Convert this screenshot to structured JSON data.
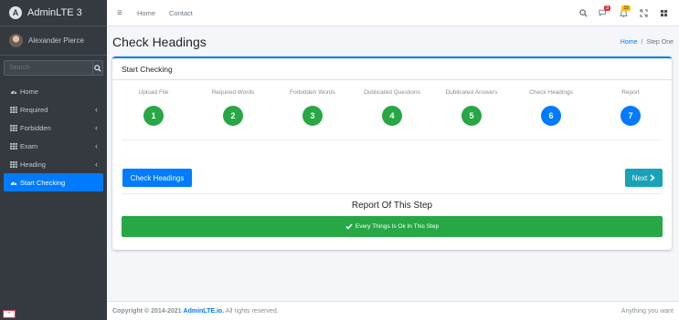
{
  "brand": {
    "name": "AdminLTE 3",
    "logo_letter": "A"
  },
  "user": {
    "name": "Alexander Pierce"
  },
  "sidebar": {
    "search_placeholder": "Search",
    "items": [
      {
        "label": "Home",
        "icon": "tachometer-icon",
        "has_children": false,
        "active": false
      },
      {
        "label": "Required",
        "icon": "grid-icon",
        "has_children": true,
        "active": false
      },
      {
        "label": "Forbidden",
        "icon": "grid-icon",
        "has_children": true,
        "active": false
      },
      {
        "label": "Exam",
        "icon": "grid-icon",
        "has_children": true,
        "active": false
      },
      {
        "label": "Heading",
        "icon": "grid-icon",
        "has_children": true,
        "active": false
      },
      {
        "label": "Start Checking",
        "icon": "tachometer-icon",
        "has_children": false,
        "active": true
      }
    ]
  },
  "topnav": {
    "links": [
      "Home",
      "Contact"
    ],
    "notif_badges": {
      "messages": "3",
      "notifications": "15"
    }
  },
  "header": {
    "title": "Check Headings",
    "breadcrumb": {
      "home": "Home",
      "current": "Step One",
      "separator": "/"
    }
  },
  "card": {
    "title": "Start Checking",
    "steps": [
      {
        "label": "Upload File",
        "number": "1",
        "state": "done"
      },
      {
        "label": "Required Words",
        "number": "2",
        "state": "done"
      },
      {
        "label": "Forbidden Words",
        "number": "3",
        "state": "done"
      },
      {
        "label": "Dublicated Questions",
        "number": "4",
        "state": "done"
      },
      {
        "label": "Dublicated Answers",
        "number": "5",
        "state": "done"
      },
      {
        "label": "Check Headings",
        "number": "6",
        "state": "current"
      },
      {
        "label": "Report",
        "number": "7",
        "state": "current"
      }
    ],
    "primary_button": "Check Headings",
    "next_button": "Next",
    "report_title": "Report Of This Step",
    "report_message": "Every Things Is Ok In This Step"
  },
  "footer": {
    "copyright_prefix": "Copyright © 2014-2021",
    "brand_link": "AdminLTE.io.",
    "rights": "All rights reserved.",
    "right_text": "Anything you want"
  },
  "colors": {
    "primary": "#007bff",
    "success": "#28a745",
    "info": "#17a2b8",
    "sidebar_bg": "#343a40"
  }
}
